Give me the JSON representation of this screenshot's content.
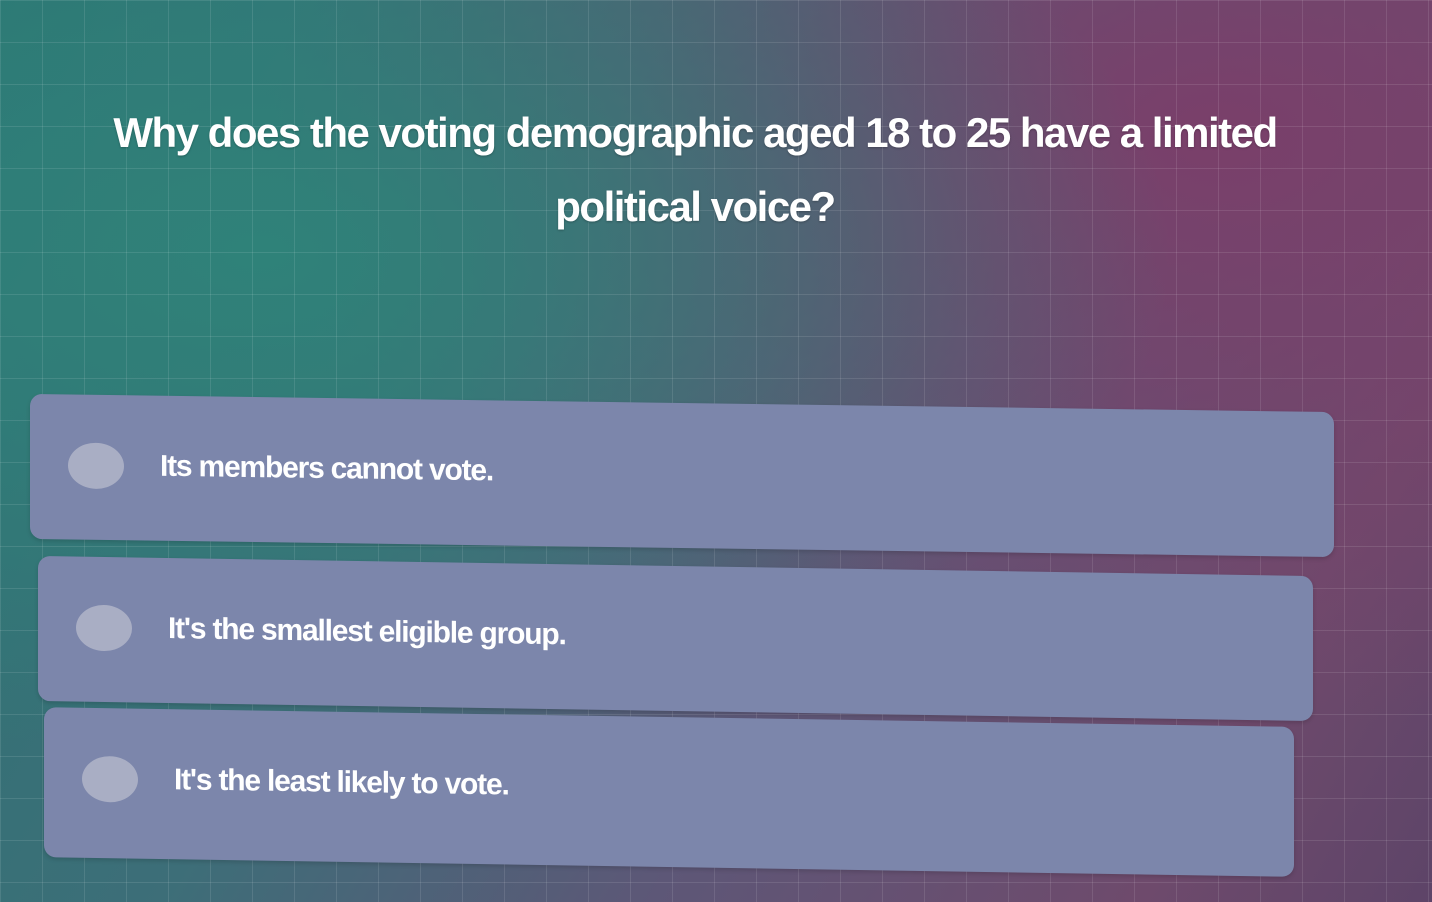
{
  "question": {
    "text": "Why does the voting demographic aged 18 to 25 have a limited political voice?"
  },
  "options": [
    {
      "label": "Its members cannot vote."
    },
    {
      "label": "It's the smallest eligible group."
    },
    {
      "label": "It's the least likely to vote."
    }
  ],
  "colors": {
    "background_teal": "#2c7574",
    "background_purple": "#6e4a6c",
    "option_background": "#7c86ab",
    "radio_fill": "#a9aec4",
    "text": "#ffffff"
  }
}
